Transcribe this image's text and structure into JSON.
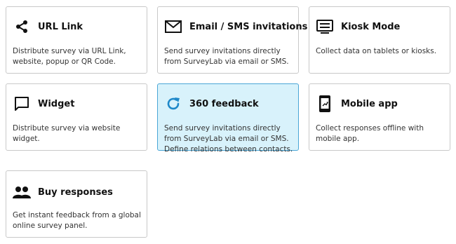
{
  "cards": [
    {
      "title": "URL Link",
      "icon": "share-icon",
      "description": "Distribute survey via URL Link, website, popup or QR Code.",
      "selected": false
    },
    {
      "title": "Email / SMS invitations",
      "icon": "envelope-icon",
      "description": "Send survey invitations directly from SurveyLab via email or SMS.",
      "selected": false
    },
    {
      "title": "Kiosk Mode",
      "icon": "kiosk-icon",
      "description": "Collect data on tablets or kiosks.",
      "selected": false
    },
    {
      "title": "Widget",
      "icon": "chat-bubble-icon",
      "description": "Distribute survey via website widget.",
      "selected": false
    },
    {
      "title": "360 feedback",
      "icon": "refresh-icon",
      "description": "Send survey invitations directly from SurveyLab via email or SMS. Define relations between contacts.",
      "selected": true
    },
    {
      "title": "Mobile app",
      "icon": "mobile-phone-icon",
      "description": "Collect responses offline with mobile app.",
      "selected": false
    },
    {
      "title": "Buy responses",
      "icon": "people-icon",
      "description": "Get instant feedback from a global online survey panel.",
      "selected": false
    }
  ],
  "colors": {
    "selected_background": "#d8f2fb",
    "selected_border": "#4aa6d6",
    "refresh_icon": "#1e88c9"
  }
}
